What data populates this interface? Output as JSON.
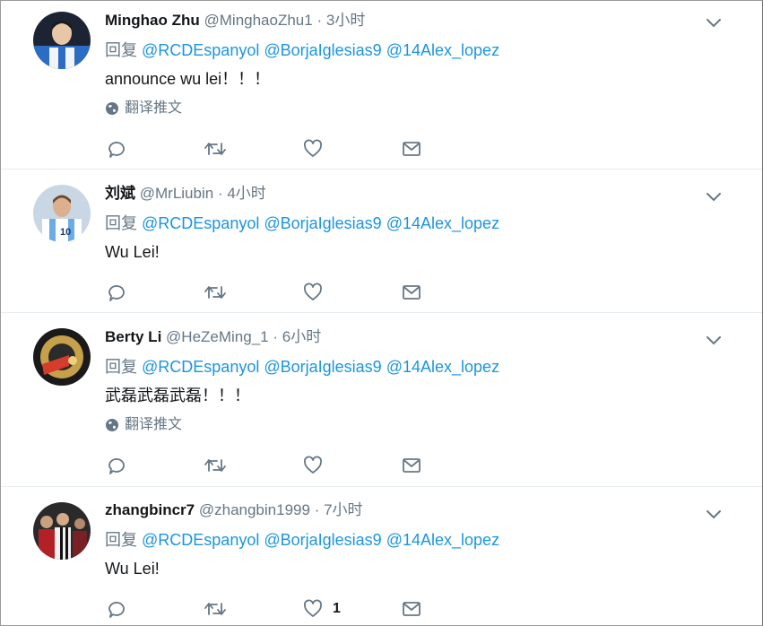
{
  "tweets": [
    {
      "name": "Minghao Zhu",
      "handle": "@MinghaoZhu1",
      "time": "3小时",
      "reply_prefix": "回复",
      "mentions": [
        "@RCDEspanyol",
        "@BorjaIglesias9",
        "@14Alex_lopez"
      ],
      "text": "announce wu lei！！！",
      "translate": "翻译推文",
      "like_count": ""
    },
    {
      "name": "刘斌",
      "handle": "@MrLiubin",
      "time": "4小时",
      "reply_prefix": "回复",
      "mentions": [
        "@RCDEspanyol",
        "@BorjaIglesias9",
        "@14Alex_lopez"
      ],
      "text": "Wu Lei!",
      "translate": "",
      "like_count": ""
    },
    {
      "name": "Berty Li",
      "handle": "@HeZeMing_1",
      "time": "6小时",
      "reply_prefix": "回复",
      "mentions": [
        "@RCDEspanyol",
        "@BorjaIglesias9",
        "@14Alex_lopez"
      ],
      "text": "武磊武磊武磊！！！",
      "translate": "翻译推文",
      "like_count": ""
    },
    {
      "name": "zhangbincr7",
      "handle": "@zhangbin1999",
      "time": "7小时",
      "reply_prefix": "回复",
      "mentions": [
        "@RCDEspanyol",
        "@BorjaIglesias9",
        "@14Alex_lopez"
      ],
      "text": "Wu Lei!",
      "translate": "",
      "like_count": "1"
    }
  ],
  "separator": "·",
  "colors": {
    "link": "#1b95e0",
    "secondary": "#657786",
    "primary": "#14171a",
    "divider": "#e6ecf0"
  },
  "icons": [
    "globe-icon",
    "reply-icon",
    "retweet-icon",
    "like-icon",
    "dm-icon",
    "chevron-down-icon"
  ]
}
